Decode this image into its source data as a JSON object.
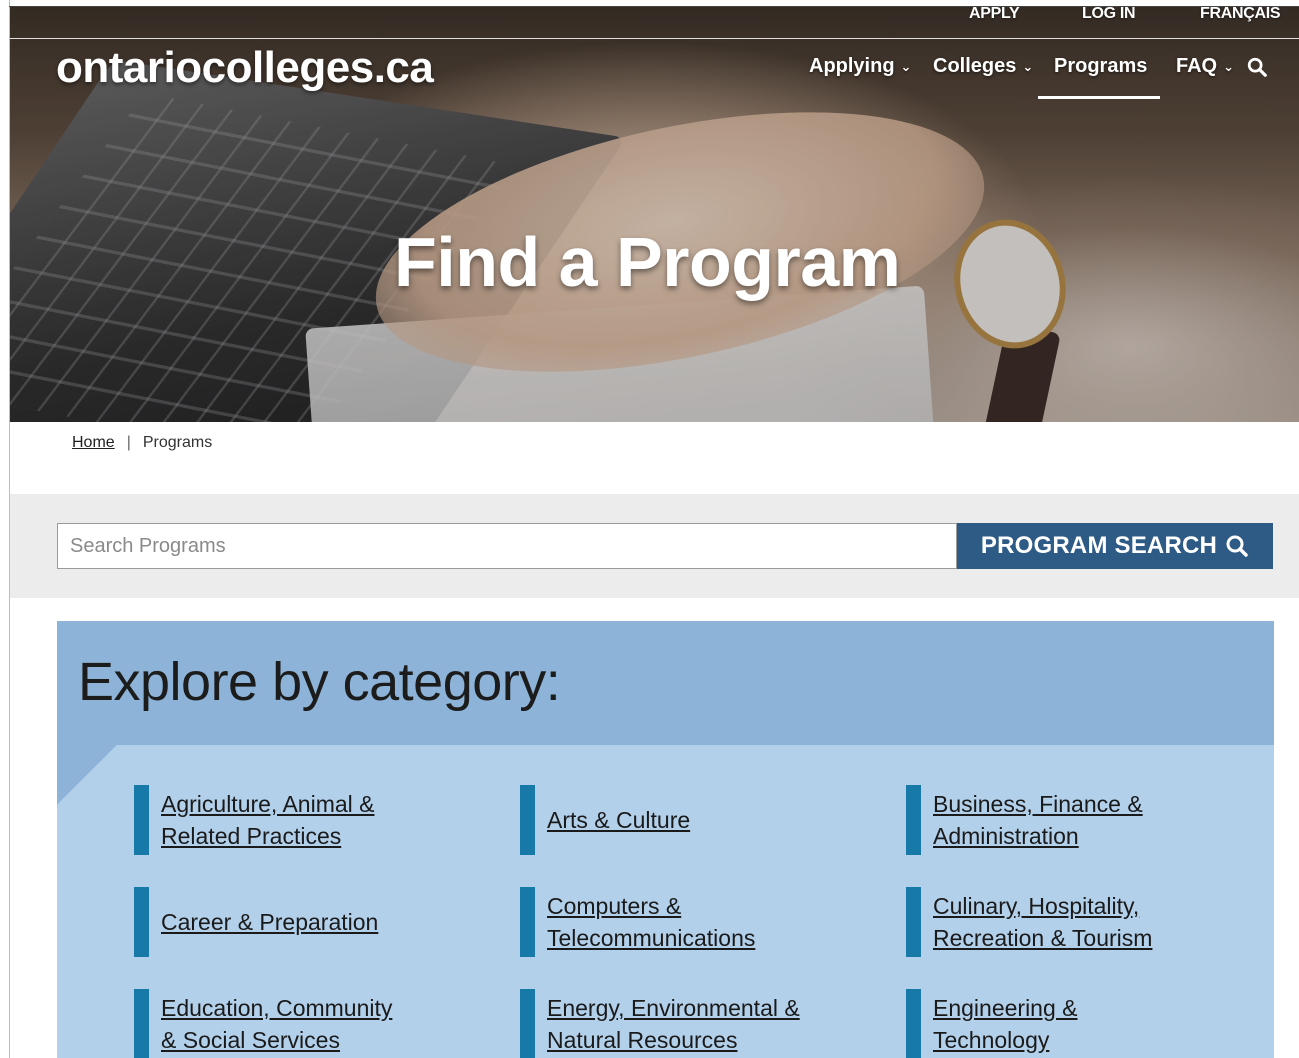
{
  "top_links": {
    "apply": "APPLY",
    "login": "LOG IN",
    "francais": "FRANÇAIS"
  },
  "logo_text": "ontariocolleges.ca",
  "nav": {
    "applying": "Applying",
    "colleges": "Colleges",
    "programs": "Programs",
    "faq": "FAQ",
    "active": "Programs"
  },
  "hero": {
    "title": "Find a Program"
  },
  "breadcrumb": {
    "home": "Home",
    "separator": "|",
    "current": "Programs"
  },
  "search": {
    "placeholder": "Search Programs",
    "value": "",
    "button_label": "PROGRAM SEARCH"
  },
  "categories": {
    "title": "Explore by category:",
    "items": [
      {
        "line1": "Agriculture, Animal &",
        "line2": "Related Practices"
      },
      {
        "line1": "Arts & Culture",
        "line2": ""
      },
      {
        "line1": "Business, Finance &",
        "line2": "Administration"
      },
      {
        "line1": "Career & Preparation",
        "line2": ""
      },
      {
        "line1": "Computers &",
        "line2": "Telecommunications"
      },
      {
        "line1": "Culinary, Hospitality,",
        "line2": "Recreation & Tourism"
      },
      {
        "line1": "Education, Community",
        "line2": "& Social Services"
      },
      {
        "line1": "Energy, Environmental &",
        "line2": "Natural Resources"
      },
      {
        "line1": "Engineering &",
        "line2": "Technology"
      }
    ]
  },
  "colors": {
    "button_blue": "#2e5b86",
    "category_bar": "#1679a8",
    "panel_light": "#b3d0eb",
    "panel_header": "#8db4d8"
  },
  "icons": {
    "search": "search-icon",
    "chevron": "chevron-down-icon"
  }
}
